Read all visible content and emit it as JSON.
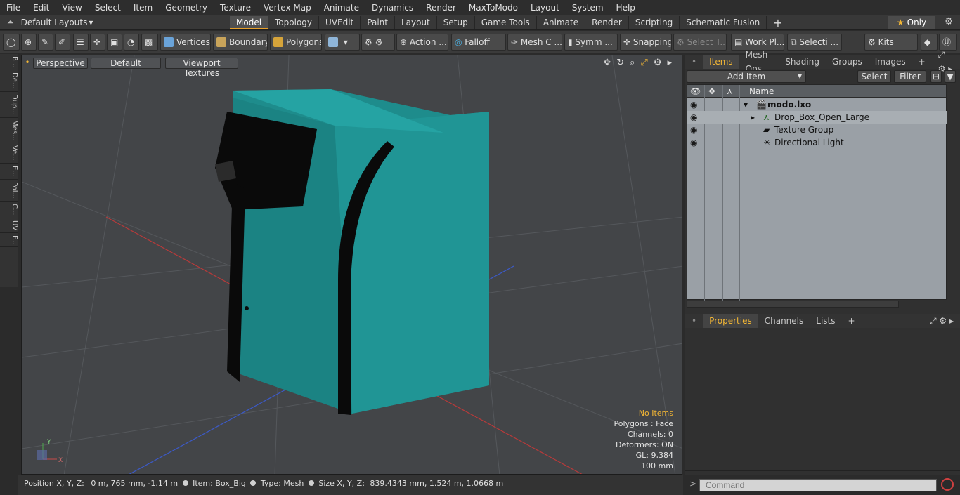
{
  "menu": [
    "File",
    "Edit",
    "View",
    "Select",
    "Item",
    "Geometry",
    "Texture",
    "Vertex Map",
    "Animate",
    "Dynamics",
    "Render",
    "MaxToModo",
    "Layout",
    "System",
    "Help"
  ],
  "layout_dropdown": "Default Layouts",
  "mode_tabs": [
    "Model",
    "Topology",
    "UVEdit",
    "Paint",
    "Layout",
    "Setup",
    "Game Tools",
    "Animate",
    "Render",
    "Scripting",
    "Schematic Fusion"
  ],
  "active_tab": "Model",
  "only_label": "Only",
  "toolbar": {
    "vertices": "Vertices",
    "boundary": "Boundary",
    "polygons": "Polygons",
    "action": "Action",
    "falloff": "Falloff",
    "mesh": "Mesh C ...",
    "symm": "Symm ...",
    "snapping": "Snapping",
    "select_t": "Select T...",
    "work_pl": "Work Pl...",
    "selecti": "Selecti ...",
    "kits": "Kits"
  },
  "left_tabs": [
    "B...",
    "De...",
    "Dup...",
    "Mes...",
    "Ve...",
    "E...",
    "Pol...",
    "C...",
    "UV",
    "F..."
  ],
  "viewport": {
    "perspective": "Perspective",
    "default": "Default",
    "textures": "Viewport Textures",
    "info": {
      "no_items": "No Items",
      "polygons": "Polygons : Face",
      "channels": "Channels: 0",
      "deformers": "Deformers: ON",
      "gl": "GL: 9,384",
      "unit": "100 mm"
    }
  },
  "status": {
    "position_label": "Position X, Y, Z:",
    "position_value": "0 m, 765 mm, -1.14 m",
    "item_label": "Item:",
    "item_value": "Box_Big",
    "type_label": "Type:",
    "type_value": "Mesh",
    "size_label": "Size X, Y, Z:",
    "size_value": "839.4343 mm, 1.524 m, 1.0668 m"
  },
  "items_panel": {
    "tabs": [
      "Items",
      "Mesh Ops",
      "Shading",
      "Groups",
      "Images"
    ],
    "add_item": "Add Item",
    "select": "Select",
    "filter": "Filter",
    "name_header": "Name",
    "tree": [
      "modo.lxo",
      "Drop_Box_Open_Large",
      "Texture Group",
      "Directional Light"
    ]
  },
  "properties_panel": {
    "tabs": [
      "Properties",
      "Channels",
      "Lists"
    ]
  },
  "command_placeholder": "Command",
  "colors": {
    "accent": "#f2b635",
    "model_teal": "#1b8a8a"
  }
}
